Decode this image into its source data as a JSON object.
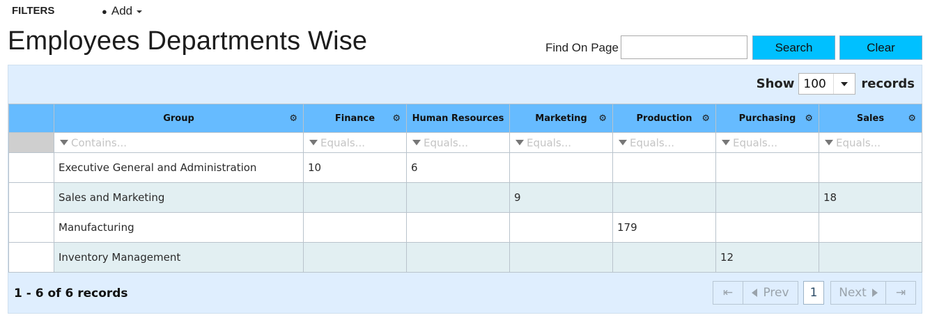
{
  "topbar": {
    "filters_label": "FILTERS",
    "add_label": "Add"
  },
  "page": {
    "title": "Employees Departments Wise"
  },
  "find": {
    "label": "Find On Page",
    "value": "",
    "search_label": "Search",
    "clear_label": "Clear"
  },
  "toolbar": {
    "show_label": "Show",
    "page_size": "100",
    "records_label": "records"
  },
  "grid": {
    "columns": [
      {
        "label": "Group",
        "filter_placeholder": "Contains..."
      },
      {
        "label": "Finance",
        "filter_placeholder": "Equals..."
      },
      {
        "label": "Human Resources",
        "filter_placeholder": "Equals..."
      },
      {
        "label": "Marketing",
        "filter_placeholder": "Equals..."
      },
      {
        "label": "Production",
        "filter_placeholder": "Equals..."
      },
      {
        "label": "Purchasing",
        "filter_placeholder": "Equals..."
      },
      {
        "label": "Sales",
        "filter_placeholder": "Equals..."
      }
    ],
    "rows": [
      [
        "Executive General and Administration",
        "10",
        "6",
        "",
        "",
        "",
        ""
      ],
      [
        "Sales and Marketing",
        "",
        "",
        "9",
        "",
        "",
        "18"
      ],
      [
        "Manufacturing",
        "",
        "",
        "",
        "179",
        "",
        ""
      ],
      [
        "Inventory Management",
        "",
        "",
        "",
        "",
        "12",
        ""
      ]
    ]
  },
  "footer": {
    "count_text": "1 - 6 of 6 records",
    "prev_label": "Prev",
    "next_label": "Next",
    "current_page": "1"
  },
  "colors": {
    "header_bg": "#66bbff",
    "button_bg": "#00c0ff",
    "panel_bg": "#dfeefe",
    "alt_row_bg": "#e2eff2"
  }
}
